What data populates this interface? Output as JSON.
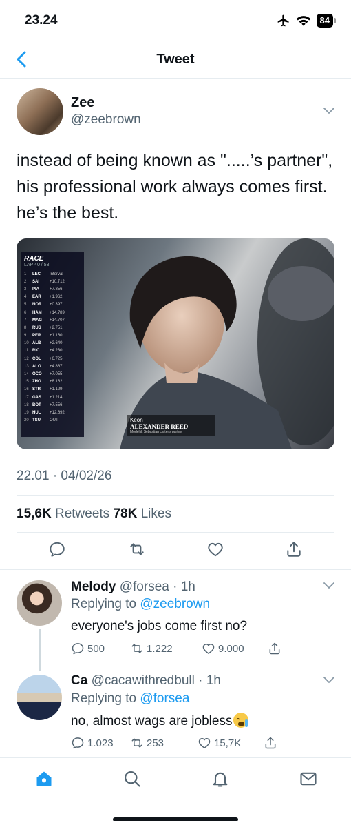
{
  "status_bar": {
    "time": "23.24",
    "battery": "84",
    "icons": [
      "airplane-icon",
      "wifi-icon",
      "battery-icon"
    ]
  },
  "nav": {
    "title": "Tweet",
    "back_icon": "chevron-left-icon"
  },
  "tweet": {
    "author_name": "Zee",
    "author_handle": "@zeebrown",
    "text": "instead of being known as \".....’s partner\", his professional work always comes first. he’s the best.",
    "media": {
      "board_brand": "RACE",
      "board_lap": "LAP 40 / 53",
      "board_rows": [
        {
          "pos": "1",
          "driver": "LEC",
          "gap": "Interval"
        },
        {
          "pos": "2",
          "driver": "SAI",
          "gap": "+10.712"
        },
        {
          "pos": "3",
          "driver": "PIA",
          "gap": "+7.856"
        },
        {
          "pos": "4",
          "driver": "EAR",
          "gap": "+1.962"
        },
        {
          "pos": "5",
          "driver": "NOR",
          "gap": "+0.397"
        },
        {
          "pos": "6",
          "driver": "HAM",
          "gap": "+14.789"
        },
        {
          "pos": "7",
          "driver": "MAG",
          "gap": "+14.707"
        },
        {
          "pos": "8",
          "driver": "RUS",
          "gap": "+2.751"
        },
        {
          "pos": "9",
          "driver": "PER",
          "gap": "+1.160"
        },
        {
          "pos": "10",
          "driver": "ALB",
          "gap": "+2.640"
        },
        {
          "pos": "11",
          "driver": "RIC",
          "gap": "+4.230"
        },
        {
          "pos": "12",
          "driver": "COL",
          "gap": "+6.725"
        },
        {
          "pos": "13",
          "driver": "ALO",
          "gap": "+4.867"
        },
        {
          "pos": "14",
          "driver": "OCO",
          "gap": "+7.055"
        },
        {
          "pos": "15",
          "driver": "ZHO",
          "gap": "+8.162"
        },
        {
          "pos": "16",
          "driver": "STR",
          "gap": "+1.129"
        },
        {
          "pos": "17",
          "driver": "GAS",
          "gap": "+1.214"
        },
        {
          "pos": "18",
          "driver": "BOT",
          "gap": "+7.556"
        },
        {
          "pos": "19",
          "driver": "HUL",
          "gap": "+12.692"
        },
        {
          "pos": "20",
          "driver": "TSU",
          "gap": "OUT"
        }
      ],
      "caption_small": "Keon",
      "caption_name": "ALEXANDER REED",
      "caption_sub": "Model & Sebastian carter's partner"
    },
    "timestamp": "22.01 · 04/02/26",
    "retweets_count": "15,6K",
    "retweets_label": "Retweets",
    "likes_count": "78K",
    "likes_label": "Likes",
    "actions": [
      "reply-icon",
      "retweet-icon",
      "like-icon",
      "share-icon"
    ]
  },
  "replies": [
    {
      "name": "Melody",
      "handle": "@forsea",
      "time": "· 1h",
      "replying_prefix": "Replying to",
      "replying_to": "@zeebrown",
      "text": "everyone's jobs come first no?",
      "reply_count": "500",
      "retweet_count": "1.222",
      "like_count": "9.000"
    },
    {
      "name": "Ca",
      "handle": "@cacawithredbull",
      "time": "· 1h",
      "replying_prefix": "Replying to",
      "replying_to": "@forsea",
      "text": "no, almost wags are jobless",
      "reply_count": "1.023",
      "retweet_count": "253",
      "like_count": "15,7K"
    }
  ],
  "tab_bar": {
    "tabs": [
      "home-icon",
      "search-icon",
      "notifications-icon",
      "messages-icon"
    ],
    "active": "home-icon"
  },
  "colors": {
    "accent": "#1d9bf0",
    "text": "#0f1419",
    "secondary": "#536471",
    "divider": "#e6ecf0"
  }
}
